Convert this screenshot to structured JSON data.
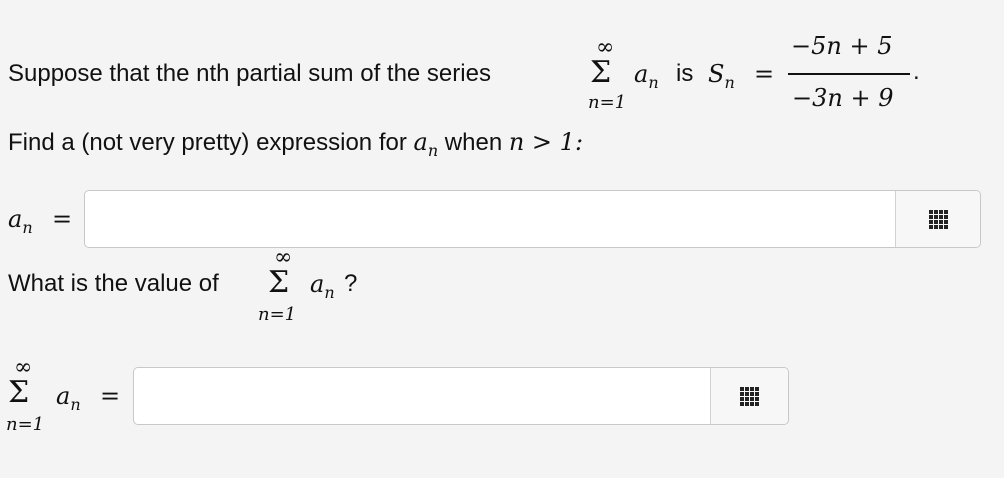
{
  "problem": {
    "intro_text": "Suppose that the nth partial sum of the series",
    "sigma_symbol": "Σ",
    "sum_upper": "∞",
    "sum_lower": "n=1",
    "term": "a",
    "term_sub": "n",
    "is_text": "is",
    "partial_sum": "S",
    "partial_sum_sub": "n",
    "equals": "=",
    "numerator": "−5n + 5",
    "denominator": "−3n + 9",
    "period": "."
  },
  "question1": {
    "prompt_pre": "Find a (not very pretty) expression for",
    "term": "a",
    "term_sub": "n",
    "prompt_mid": "when",
    "condition": "n > 1:",
    "answer_label_term": "a",
    "answer_label_sub": "n",
    "answer_label_eq": "=",
    "answer_value": "",
    "matrix_icon": "grid-icon"
  },
  "question2": {
    "prompt_pre": "What is the value of",
    "sigma_symbol": "Σ",
    "sum_upper": "∞",
    "sum_lower": "n=1",
    "term": "a",
    "term_sub": "n",
    "prompt_post": "?",
    "answer_sigma": "Σ",
    "answer_upper": "∞",
    "answer_lower": "n=1",
    "answer_term": "a",
    "answer_sub": "n",
    "answer_eq": "=",
    "answer_value": "",
    "matrix_icon": "grid-icon"
  }
}
